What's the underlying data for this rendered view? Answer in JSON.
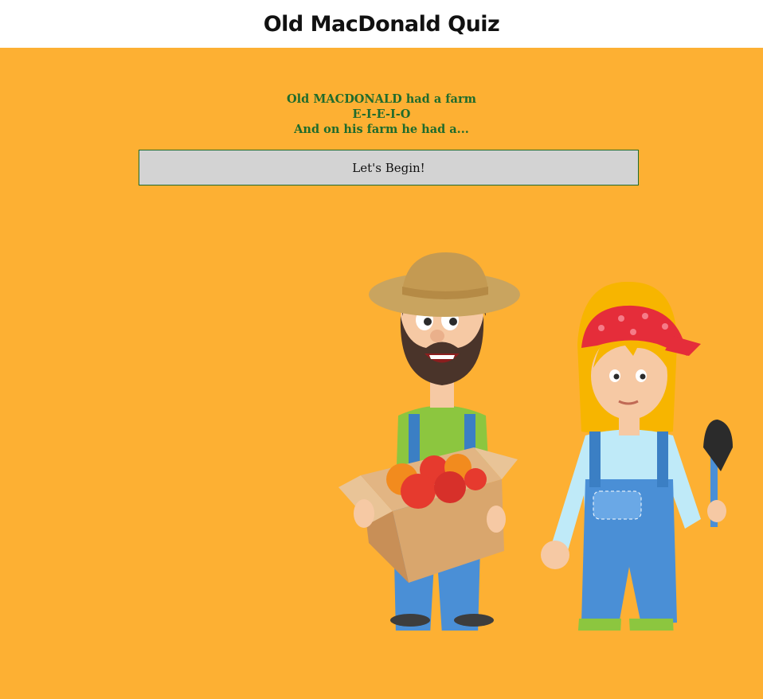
{
  "header": {
    "title": "Old MacDonald Quiz"
  },
  "intro": {
    "lines": [
      "Old MACDONALD had a farm",
      "E-I-E-I-O",
      "And on his farm he had a..."
    ]
  },
  "start_button": {
    "label": "Let's Begin!"
  },
  "illustration": {
    "icon": "farmers-illustration"
  },
  "colors": {
    "background": "#fdb033",
    "accent_text": "#1f6b2c",
    "button": "#d3d3d3"
  }
}
